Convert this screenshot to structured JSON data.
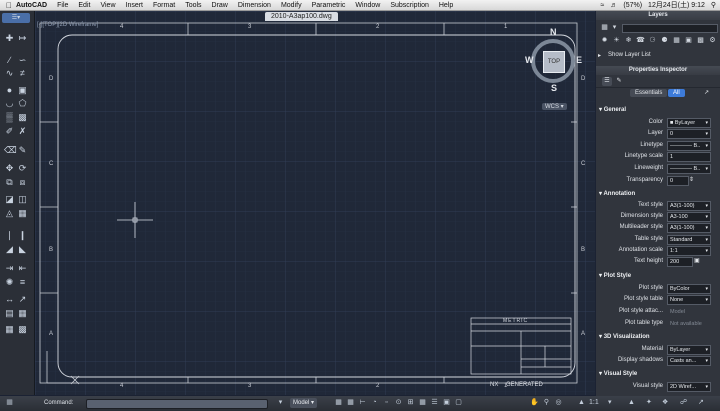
{
  "menubar": {
    "apple": "",
    "items": [
      "AutoCAD",
      "File",
      "Edit",
      "View",
      "Insert",
      "Format",
      "Tools",
      "Draw",
      "Dimension",
      "Modify",
      "Parametric",
      "Window",
      "Subscription",
      "Help"
    ],
    "right": {
      "battery": "(57%)",
      "datetime": "12月24日(土)  9:12"
    }
  },
  "document": {
    "tab_title": "2010-A3ap100.dwg",
    "view_label": "[-][TOP][2D Wireframe]",
    "wcs_label": "WCS"
  },
  "viewcube": {
    "north": "N",
    "south": "S",
    "east": "E",
    "west": "W",
    "face": "TOP"
  },
  "frame": {
    "top_numbers": [
      "4",
      "3",
      "2",
      "1"
    ],
    "bottom_numbers": [
      "4",
      "3",
      "2",
      "1"
    ],
    "left_letters": [
      "D",
      "C",
      "B",
      "A"
    ],
    "right_letters": [
      "D",
      "C",
      "B",
      "A"
    ]
  },
  "titleblock": {
    "header": "METRIC",
    "left_bottom": "NX",
    "right_bottom": "GENERATED"
  },
  "command": {
    "label": "Command:"
  },
  "status": {
    "model_label": "Model",
    "scale_label": "1:1"
  },
  "layers": {
    "title": "Layers",
    "show_list_label": "Show Layer List"
  },
  "inspector": {
    "title": "Properties Inspector",
    "tabs": {
      "essentials": "Essentials",
      "all": "All"
    },
    "sections": [
      {
        "title": "General",
        "rows": [
          {
            "label": "Color",
            "value": "ByLayer"
          },
          {
            "label": "Layer",
            "value": "0"
          },
          {
            "label": "Linetype",
            "value": "———— B.."
          },
          {
            "label": "Linetype scale",
            "value": "1"
          },
          {
            "label": "Lineweight",
            "value": "———— B.."
          },
          {
            "label": "Transparency",
            "value": "0"
          }
        ]
      },
      {
        "title": "Annotation",
        "rows": [
          {
            "label": "Text style",
            "value": "A3(1-100)"
          },
          {
            "label": "Dimension style",
            "value": "A3-100"
          },
          {
            "label": "Multileader style",
            "value": "A3(1-100)"
          },
          {
            "label": "Table style",
            "value": "Standard"
          },
          {
            "label": "Annotation scale",
            "value": "1:1"
          },
          {
            "label": "Text height",
            "value": "200"
          }
        ]
      },
      {
        "title": "Plot Style",
        "rows": [
          {
            "label": "Plot style",
            "value": "ByColor"
          },
          {
            "label": "Plot style table",
            "value": "None"
          },
          {
            "label": "Plot style attac...",
            "value": "Model"
          },
          {
            "label": "Plot table type",
            "value": "Not available"
          }
        ]
      },
      {
        "title": "3D Visualization",
        "rows": [
          {
            "label": "Material",
            "value": "ByLayer"
          },
          {
            "label": "Display shadows",
            "value": "Casts an..."
          }
        ]
      },
      {
        "title": "Visual Style",
        "rows": [
          {
            "label": "Visual style",
            "value": "2D Wiref..."
          }
        ]
      }
    ]
  },
  "colors": {
    "background": "#202838",
    "grid": "#2a3346",
    "panel": "#31353d",
    "accent": "#3d7bd9"
  }
}
